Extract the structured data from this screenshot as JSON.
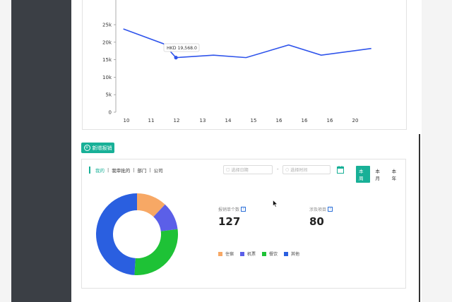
{
  "chart_data": {
    "type": "line",
    "categories": [
      "10",
      "11",
      "12",
      "13",
      "14",
      "15",
      "16",
      "16",
      "16",
      "20"
    ],
    "series": [
      {
        "values": [
          23800,
          19568,
          15600,
          16300,
          15600,
          19200,
          16300,
          18200
        ]
      }
    ],
    "x_positions": [
      "10",
      "11.6",
      "12.1",
      "13.6",
      "14.9",
      "16.6",
      "17.9",
      "19.9"
    ],
    "yticks": [
      "0",
      "5k",
      "10k",
      "15k",
      "20k",
      "25k"
    ],
    "ylim": [
      0,
      27000
    ],
    "tooltip": "HKD 19,568.0",
    "color": "#2f54eb"
  },
  "toolbar": {
    "add_label": "新增报销"
  },
  "scope_tabs": [
    "我的",
    "我审批的",
    "部门",
    "公司"
  ],
  "filters": {
    "date_placeholder": "选择日期",
    "time_placeholder": "选择时间",
    "separator": "-",
    "periods": [
      "本周",
      "本月",
      "本年"
    ]
  },
  "stats": [
    {
      "label": "报销单个数",
      "value": "127"
    },
    {
      "label": "涉及项目",
      "value": "80"
    }
  ],
  "donut": {
    "slices": [
      {
        "label": "住宿",
        "value": 12,
        "color": "#f7a865"
      },
      {
        "label": "机票",
        "value": 11,
        "color": "#5b5fe8"
      },
      {
        "label": "餐饮",
        "value": 28,
        "color": "#1ec236"
      },
      {
        "label": "其他",
        "value": 49,
        "color": "#2a5fe0"
      }
    ]
  }
}
